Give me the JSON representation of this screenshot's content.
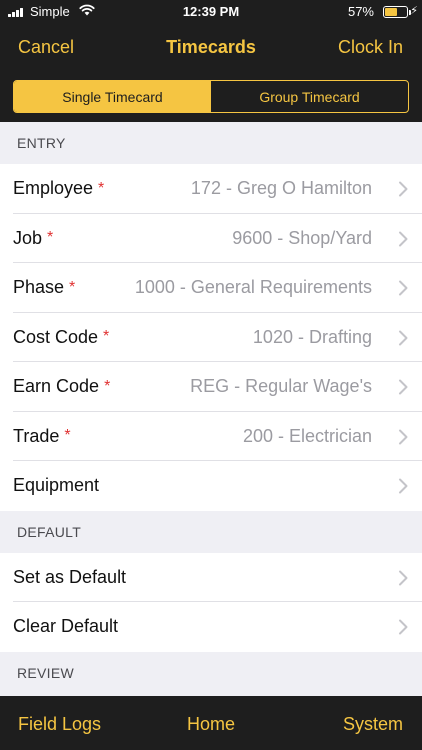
{
  "status_bar": {
    "carrier": "Simple",
    "time": "12:39 PM",
    "battery_percent": "57%",
    "battery_level": 0.57,
    "battery_color": "#f5c542"
  },
  "nav": {
    "left": "Cancel",
    "title": "Timecards",
    "right": "Clock In"
  },
  "segment": {
    "options": [
      "Single Timecard",
      "Group Timecard"
    ],
    "selected_index": 0
  },
  "sections": {
    "entry": {
      "header": "ENTRY",
      "rows": [
        {
          "label": "Employee",
          "required": "*",
          "value": "172 - Greg O Hamilton"
        },
        {
          "label": "Job",
          "required": "*",
          "value": "9600 - Shop/Yard"
        },
        {
          "label": "Phase",
          "required": "*",
          "value": "1000 - General Requirements"
        },
        {
          "label": "Cost Code",
          "required": "*",
          "value": "1020 - Drafting"
        },
        {
          "label": "Earn Code",
          "required": "*",
          "value": "REG - Regular Wage's"
        },
        {
          "label": "Trade",
          "required": "*",
          "value": "200 - Electrician"
        },
        {
          "label": "Equipment",
          "required": "",
          "value": ""
        }
      ]
    },
    "default": {
      "header": "DEFAULT",
      "rows": [
        {
          "label": "Set as Default"
        },
        {
          "label": "Clear Default"
        }
      ]
    },
    "review": {
      "header": "REVIEW"
    }
  },
  "tab_bar": {
    "items": [
      "Field Logs",
      "Home",
      "System"
    ]
  },
  "colors": {
    "accent": "#f5c542",
    "bar_background": "#1e1e1e",
    "required_marker": "#e03131",
    "value_text": "#9b9ba1"
  },
  "icons": {
    "row_disclosure": "chevron-right-icon",
    "wifi": "wifi-icon",
    "signal": "signal-icon",
    "battery": "battery-icon",
    "charging": "charging-bolt-icon"
  }
}
